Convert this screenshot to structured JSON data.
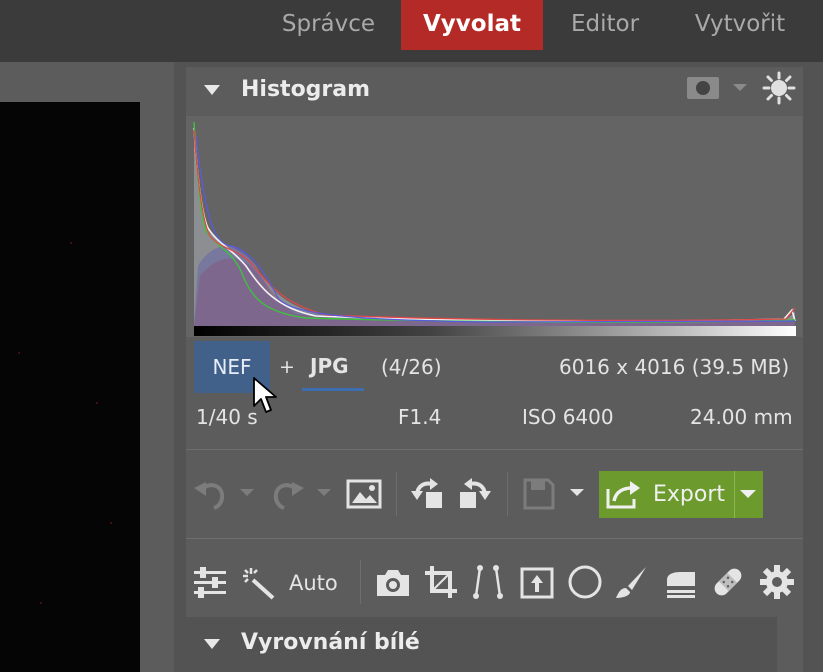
{
  "nav": {
    "tabs": [
      {
        "label": "Správce"
      },
      {
        "label": "Vyvolat"
      },
      {
        "label": "Editor"
      },
      {
        "label": "Vytvořit"
      }
    ]
  },
  "histogram": {
    "title": "Histogram"
  },
  "file_info": {
    "format_raw": "NEF",
    "plus": "+",
    "format_jpg": "JPG",
    "counter": "(4/26)",
    "dimensions": "6016 x 4016 (39.5 MB)",
    "shutter": "1/40 s",
    "aperture": "F1.4",
    "iso": "ISO 6400",
    "focal_length": "24.00 mm"
  },
  "toolbar": {
    "export_label": "Export",
    "auto_label": "Auto"
  },
  "sections": {
    "white_balance": "Vyrovnání bílé"
  },
  "colors": {
    "active_tab": "#b42a26",
    "export_button": "#6c9a2c",
    "nef_highlight": "#41608a"
  }
}
